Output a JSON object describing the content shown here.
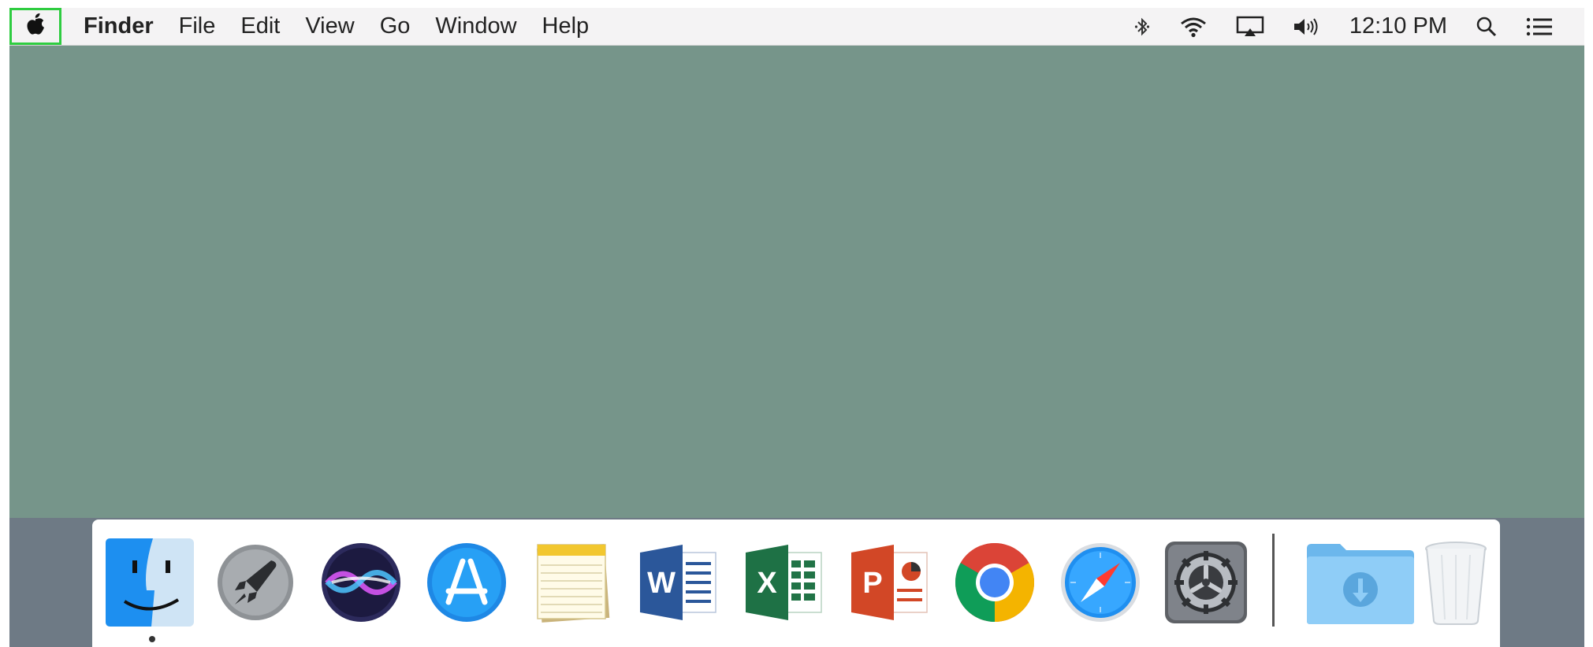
{
  "menubar": {
    "apple_icon": "apple-logo-icon",
    "app_name": "Finder",
    "menus": [
      "File",
      "Edit",
      "View",
      "Go",
      "Window",
      "Help"
    ],
    "status_icons": [
      "bluetooth-icon",
      "wifi-icon",
      "airplay-icon",
      "volume-icon"
    ],
    "clock": "12:10 PM",
    "right_icons": [
      "spotlight-search-icon",
      "notification-center-icon"
    ]
  },
  "desktop": {
    "background_color": "#76958a"
  },
  "dock": {
    "items": [
      {
        "name": "finder",
        "icon": "finder-icon",
        "running": true
      },
      {
        "name": "launchpad",
        "icon": "launchpad-rocket-icon"
      },
      {
        "name": "siri",
        "icon": "siri-icon"
      },
      {
        "name": "app-store",
        "icon": "app-store-icon"
      },
      {
        "name": "notes",
        "icon": "notes-icon"
      },
      {
        "name": "word",
        "icon": "microsoft-word-icon",
        "letter": "W"
      },
      {
        "name": "excel",
        "icon": "microsoft-excel-icon",
        "letter": "X"
      },
      {
        "name": "powerpoint",
        "icon": "microsoft-powerpoint-icon",
        "letter": "P"
      },
      {
        "name": "chrome",
        "icon": "google-chrome-icon"
      },
      {
        "name": "safari",
        "icon": "safari-compass-icon"
      },
      {
        "name": "system-preferences",
        "icon": "system-preferences-gear-icon"
      },
      {
        "name": "downloads",
        "icon": "downloads-folder-icon"
      },
      {
        "name": "trash",
        "icon": "trash-icon"
      }
    ]
  },
  "colors": {
    "highlight": "#2ecc40",
    "menubar_bg": "#f4f3f4",
    "dock_bg": "#ffffff"
  }
}
